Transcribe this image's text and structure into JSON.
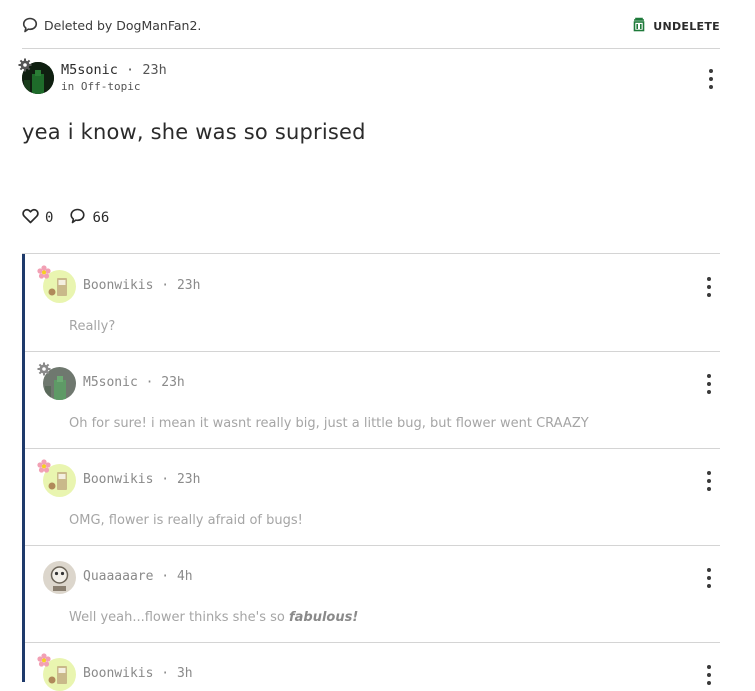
{
  "deleted_bar": {
    "text": "Deleted by DogManFan2.",
    "undelete_label": "UNDELETE",
    "accent": "#1e7a3a"
  },
  "post": {
    "author": "M5sonic",
    "separator": "·",
    "time": "23h",
    "community": "in Off-topic",
    "body": "yea i know, she was so suprised",
    "likes": "0",
    "comments": "66"
  },
  "replies": [
    {
      "author": "Boonwikis",
      "time": "23h",
      "text_before": "Really?",
      "text_emph": ""
    },
    {
      "author": "M5sonic",
      "time": "23h",
      "text_before": "Oh for sure! i mean it wasnt really big, just a little bug, but flower went CRAAZY",
      "text_emph": ""
    },
    {
      "author": "Boonwikis",
      "time": "23h",
      "text_before": "OMG, flower is really afraid of bugs!",
      "text_emph": ""
    },
    {
      "author": "Quaaaaare",
      "time": "4h",
      "text_before": "Well yeah...flower thinks she's so ",
      "text_emph": "fabulous!"
    },
    {
      "author": "Boonwikis",
      "time": "3h",
      "text_before": "",
      "text_emph": ""
    }
  ],
  "colors": {
    "thread_line": "#1e3a6b",
    "divider": "#d4d4d4"
  }
}
